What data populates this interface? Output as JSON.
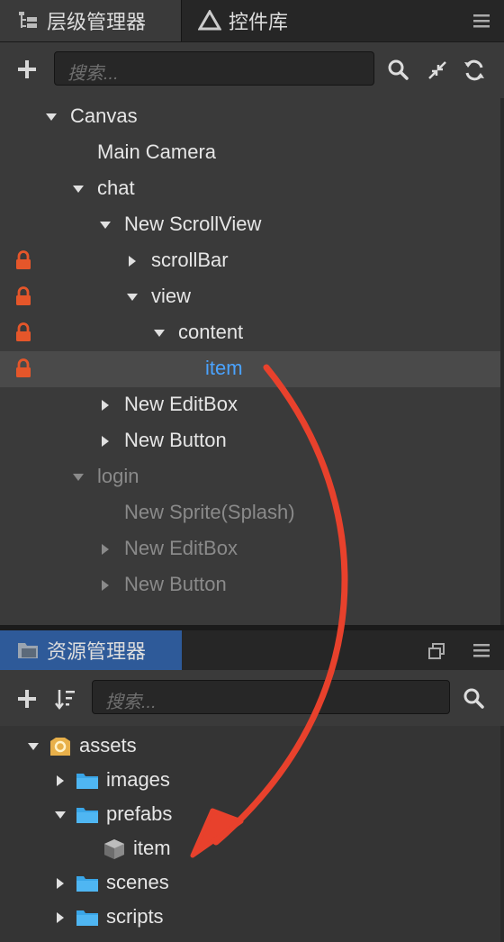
{
  "hierarchy": {
    "tab_label": "层级管理器",
    "library_tab_label": "控件库",
    "search_placeholder": "搜索...",
    "nodes": [
      {
        "label": "Canvas",
        "state": "expanded",
        "locked": false,
        "dim": false,
        "selected": false
      },
      {
        "label": "Main Camera",
        "state": "none",
        "locked": false,
        "dim": false,
        "selected": false
      },
      {
        "label": "chat",
        "state": "expanded",
        "locked": false,
        "dim": false,
        "selected": false
      },
      {
        "label": "New ScrollView",
        "state": "expanded",
        "locked": false,
        "dim": false,
        "selected": false
      },
      {
        "label": "scrollBar",
        "state": "collapsed",
        "locked": true,
        "dim": false,
        "selected": false
      },
      {
        "label": "view",
        "state": "expanded",
        "locked": true,
        "dim": false,
        "selected": false
      },
      {
        "label": "content",
        "state": "expanded",
        "locked": true,
        "dim": false,
        "selected": false
      },
      {
        "label": "item",
        "state": "none",
        "locked": true,
        "dim": false,
        "selected": true
      },
      {
        "label": "New EditBox",
        "state": "collapsed",
        "locked": false,
        "dim": false,
        "selected": false
      },
      {
        "label": "New Button",
        "state": "collapsed",
        "locked": false,
        "dim": false,
        "selected": false
      },
      {
        "label": "login",
        "state": "expanded",
        "locked": false,
        "dim": true,
        "selected": false
      },
      {
        "label": "New Sprite(Splash)",
        "state": "none",
        "locked": false,
        "dim": true,
        "selected": false
      },
      {
        "label": "New EditBox",
        "state": "collapsed",
        "locked": false,
        "dim": true,
        "selected": false
      },
      {
        "label": "New Button",
        "state": "collapsed",
        "locked": false,
        "dim": true,
        "selected": false
      }
    ]
  },
  "assets": {
    "tab_label": "资源管理器",
    "search_placeholder": "搜索...",
    "items": [
      {
        "label": "assets",
        "state": "expanded",
        "icon": "database-icon"
      },
      {
        "label": "images",
        "state": "collapsed",
        "icon": "folder-icon"
      },
      {
        "label": "prefabs",
        "state": "expanded",
        "icon": "folder-icon"
      },
      {
        "label": "item",
        "state": "none",
        "icon": "prefab-icon"
      },
      {
        "label": "scenes",
        "state": "collapsed",
        "icon": "folder-icon"
      },
      {
        "label": "scripts",
        "state": "collapsed",
        "icon": "folder-icon"
      }
    ]
  },
  "colors": {
    "panel_bg": "#3a3a3a",
    "selected_text": "#4aa3ff",
    "lock": "#e5562a",
    "active_tab": "#2e5a99",
    "annotation_arrow": "#e8412c",
    "folder": "#3aa6e8"
  }
}
